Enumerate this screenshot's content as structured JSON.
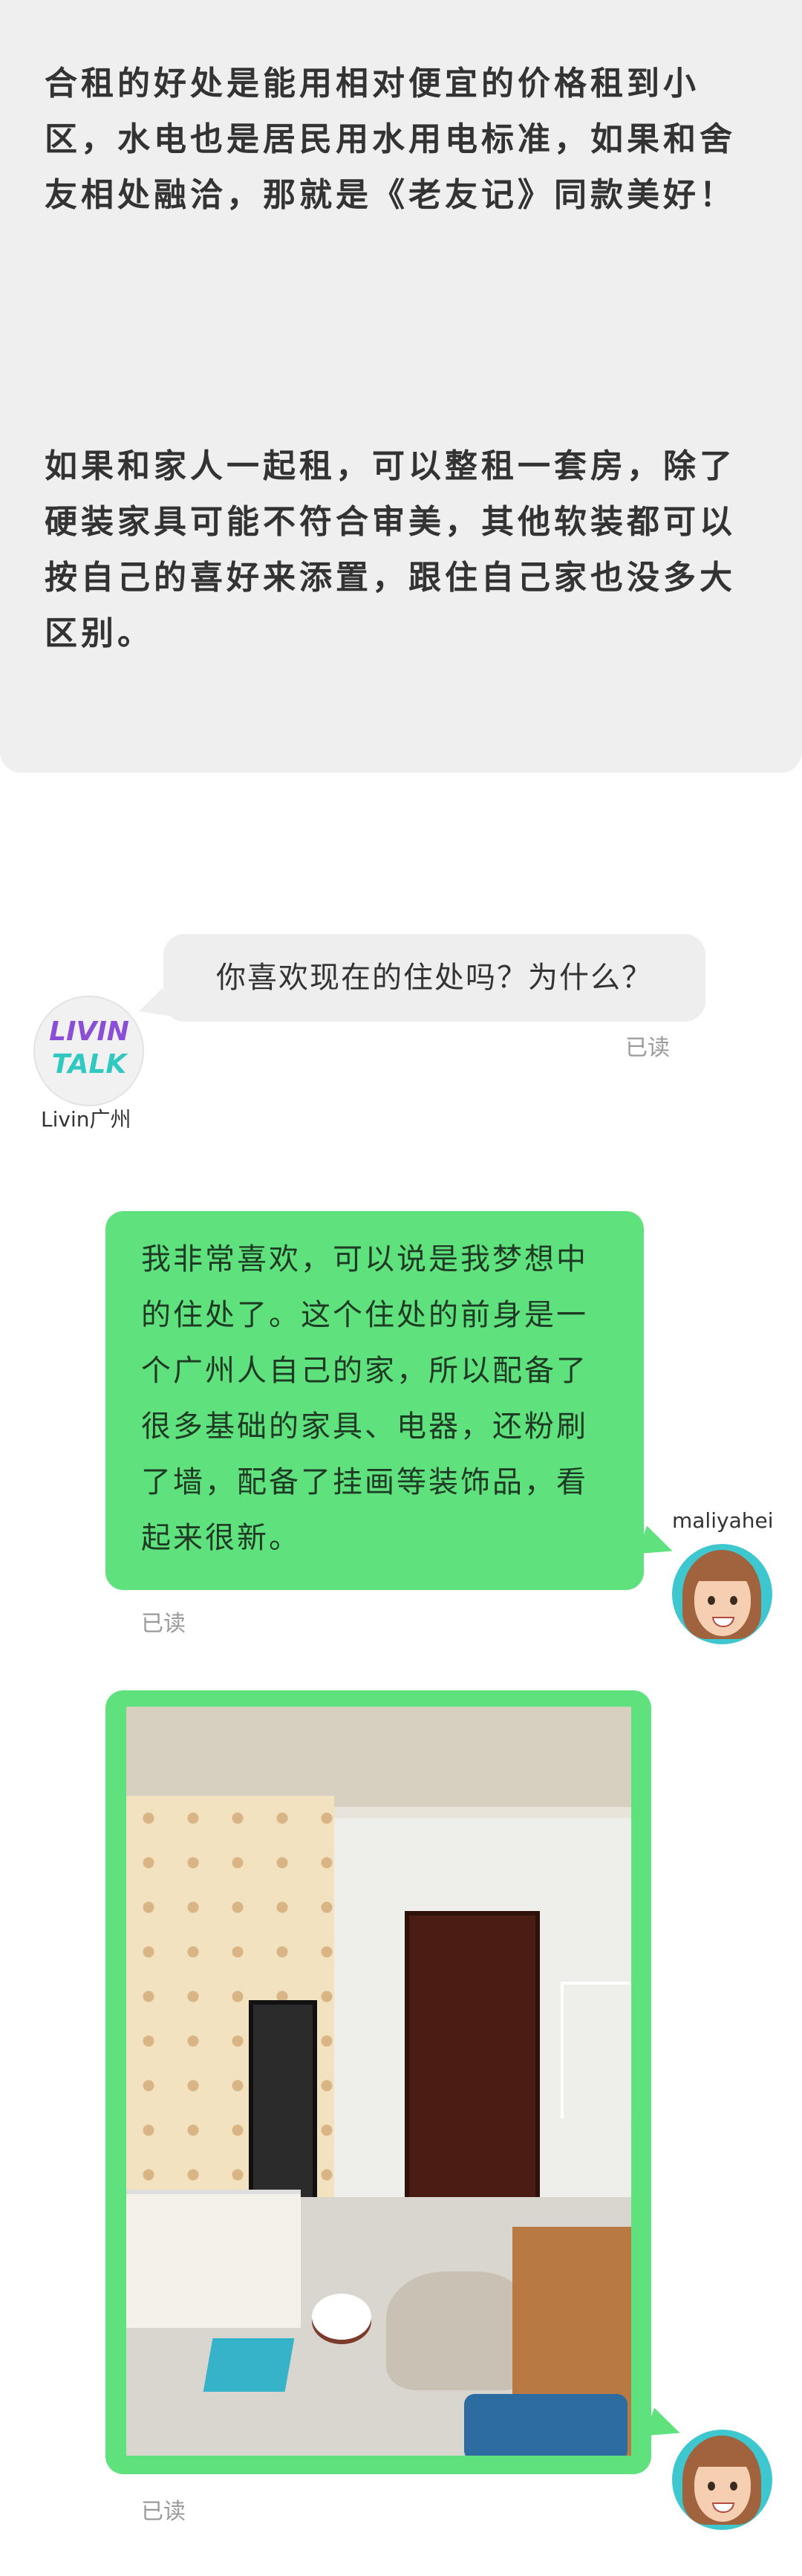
{
  "intro": {
    "paragraph1": "合租的好处是能用相对便宜的价格租到小区，水电也是居民用水用电标准，如果和舍友相处融洽，那就是《老友记》同款美好！",
    "paragraph2": "如果和家人一起租，可以整租一套房，除了硬装家具可能不符合审美，其他软装都可以按自己的喜好来添置，跟住自己家也没多大区别。"
  },
  "chat": {
    "question": {
      "text": "你喜欢现在的住处吗？为什么？",
      "read_status": "已读",
      "sender_name": "Livin广州",
      "avatar_line1": "LIVIN",
      "avatar_line2": "TALK"
    },
    "answer": {
      "text": "我非常喜欢，可以说是我梦想中的住处了。这个住处的前身是一个广州人自己的家，所以配备了很多基础的家具、电器，还粉刷了墙，配备了挂画等装饰品，看起来很新。",
      "read_status": "已读",
      "sender_name": "maliyahei"
    },
    "photo_message": {
      "read_status": "已读"
    }
  },
  "colors": {
    "bubble_green": "#5fe27e",
    "bubble_gray": "#eeeeee",
    "intro_bg": "#efefef",
    "avatar_teal": "#3fc7cf"
  }
}
